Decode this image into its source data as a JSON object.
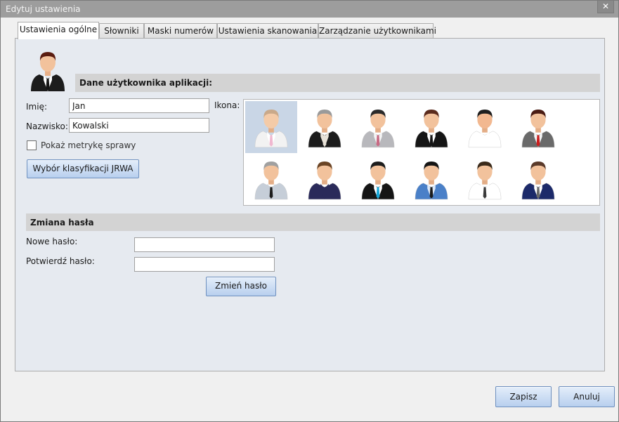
{
  "window": {
    "title": "Edytuj ustawienia",
    "close_glyph": "✕"
  },
  "tabs": [
    {
      "label": "Ustawienia ogólne",
      "active": true
    },
    {
      "label": "Słowniki",
      "active": false
    },
    {
      "label": "Maski numerów",
      "active": false
    },
    {
      "label": "Ustawienia skanowania",
      "active": false
    },
    {
      "label": "Zarządzanie użytkownikami",
      "active": false
    }
  ],
  "user_section": {
    "header": "Dane użytkownika aplikacji:",
    "first_name_label": "Imię:",
    "first_name_value": "Jan",
    "last_name_label": "Nazwisko:",
    "last_name_value": "Kowalski",
    "icon_label": "Ikona:",
    "show_metric_label": "Pokaż metrykę sprawy",
    "show_metric_checked": false,
    "jrwa_button": "Wybór klasyfikacji JRWA"
  },
  "icons": [
    {
      "name": "user-icon-1",
      "selected": true,
      "hair": "#c9a98a",
      "skin": "#f4cba8",
      "suit": "#f2f2f2",
      "shirt": "#ffffff",
      "tie": "#f0b8d0"
    },
    {
      "name": "user-icon-2",
      "selected": false,
      "hair": "#9a9a9a",
      "skin": "#f2c29c",
      "suit": "#1c1c1c",
      "shirt": "#e8e2d8",
      "tie": "#e8e2d8"
    },
    {
      "name": "user-icon-3",
      "selected": false,
      "hair": "#2a2a2a",
      "skin": "#f2c29c",
      "suit": "#b8b8bc",
      "shirt": "#f4f4f4",
      "tie": "#c86a84"
    },
    {
      "name": "user-icon-4",
      "selected": false,
      "hair": "#5a2a1c",
      "skin": "#f2c29c",
      "suit": "#151515",
      "shirt": "#ffffff",
      "tie": "#151515"
    },
    {
      "name": "user-icon-5",
      "selected": false,
      "hair": "#1e1e1e",
      "skin": "#f2b890",
      "suit": "#ffffff",
      "shirt": "#ffffff",
      "tie": "#ffffff"
    },
    {
      "name": "user-icon-6",
      "selected": false,
      "hair": "#4a1c14",
      "skin": "#f2c29c",
      "suit": "#6a6a6a",
      "shirt": "#f4f4f4",
      "tie": "#cc1f1f"
    },
    {
      "name": "user-icon-7",
      "selected": false,
      "hair": "#a0a0a0",
      "skin": "#f2c29c",
      "suit": "#c6ced8",
      "shirt": "#c6ced8",
      "tie": "#1c1c1c"
    },
    {
      "name": "user-icon-8",
      "selected": false,
      "hair": "#6a4424",
      "skin": "#f2c29c",
      "suit": "#2a2a5a",
      "shirt": "#2a2a5a",
      "tie": "#2a2a5a"
    },
    {
      "name": "user-icon-9",
      "selected": false,
      "hair": "#1c1c1c",
      "skin": "#f2c29c",
      "suit": "#151515",
      "shirt": "#ffffff",
      "tie": "#1aa8d8"
    },
    {
      "name": "user-icon-10",
      "selected": false,
      "hair": "#141414",
      "skin": "#f2c29c",
      "suit": "#4a80c8",
      "shirt": "#dce8f8",
      "tie": "#1c1c1c"
    },
    {
      "name": "user-icon-11",
      "selected": false,
      "hair": "#3a2a1a",
      "skin": "#f2c29c",
      "suit": "#ffffff",
      "shirt": "#ffffff",
      "tie": "#3a3a3a"
    },
    {
      "name": "user-icon-12",
      "selected": false,
      "hair": "#5a3a2a",
      "skin": "#f2c29c",
      "suit": "#1c2a6a",
      "shirt": "#ffffff",
      "tie": "#6a6a6a"
    }
  ],
  "password_section": {
    "header": "Zmiana hasła",
    "new_password_label": "Nowe hasło:",
    "new_password_value": "",
    "confirm_password_label": "Potwierdź hasło:",
    "confirm_password_value": "",
    "change_button": "Zmień hasło"
  },
  "footer": {
    "save_button": "Zapisz",
    "cancel_button": "Anuluj"
  },
  "colors": {
    "header_bg": "#d3d3d3",
    "panel_bg": "#e6eaf0",
    "button_border": "#6d8fbe",
    "title_bar": "#9d9d9d"
  }
}
